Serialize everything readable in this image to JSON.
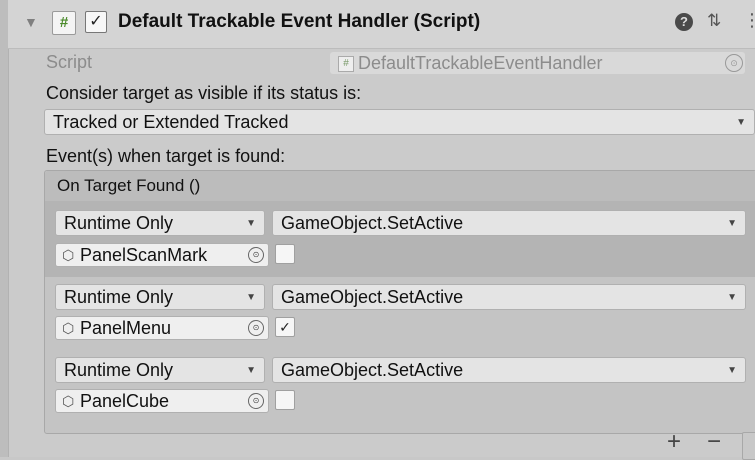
{
  "header": {
    "fold_glyph": "▼",
    "script_icon_glyph": "#",
    "enabled_glyph": "✓",
    "title": "Default Trackable Event Handler (Script)",
    "help_glyph": "?",
    "presets_glyph": "⇅",
    "more_glyph": "⋮"
  },
  "script_row": {
    "label": "Script",
    "value": "DefaultTrackableEventHandler",
    "icon_glyph": "#",
    "pick_glyph": "⊙"
  },
  "status": {
    "label": "Consider target as visible if its status is:",
    "selected": "Tracked or Extended Tracked"
  },
  "events": {
    "label": "Event(s) when target is found:",
    "header": "On Target Found ()",
    "entries": [
      {
        "mode": "Runtime Only",
        "function": "GameObject.SetActive",
        "object": "PanelScanMark",
        "checked": ""
      },
      {
        "mode": "Runtime Only",
        "function": "GameObject.SetActive",
        "object": "PanelMenu",
        "checked": "✓"
      },
      {
        "mode": "Runtime Only",
        "function": "GameObject.SetActive",
        "object": "PanelCube",
        "checked": ""
      }
    ],
    "add_glyph": "+",
    "remove_glyph": "−"
  },
  "icons": {
    "dropdown_arrow": "▼",
    "object_icon": "⬡",
    "pick": "⊙"
  },
  "colors": {
    "background": "#cbcbcb",
    "selected_entry": "#b4b4b4",
    "script_icon": "#4a8a2a"
  }
}
